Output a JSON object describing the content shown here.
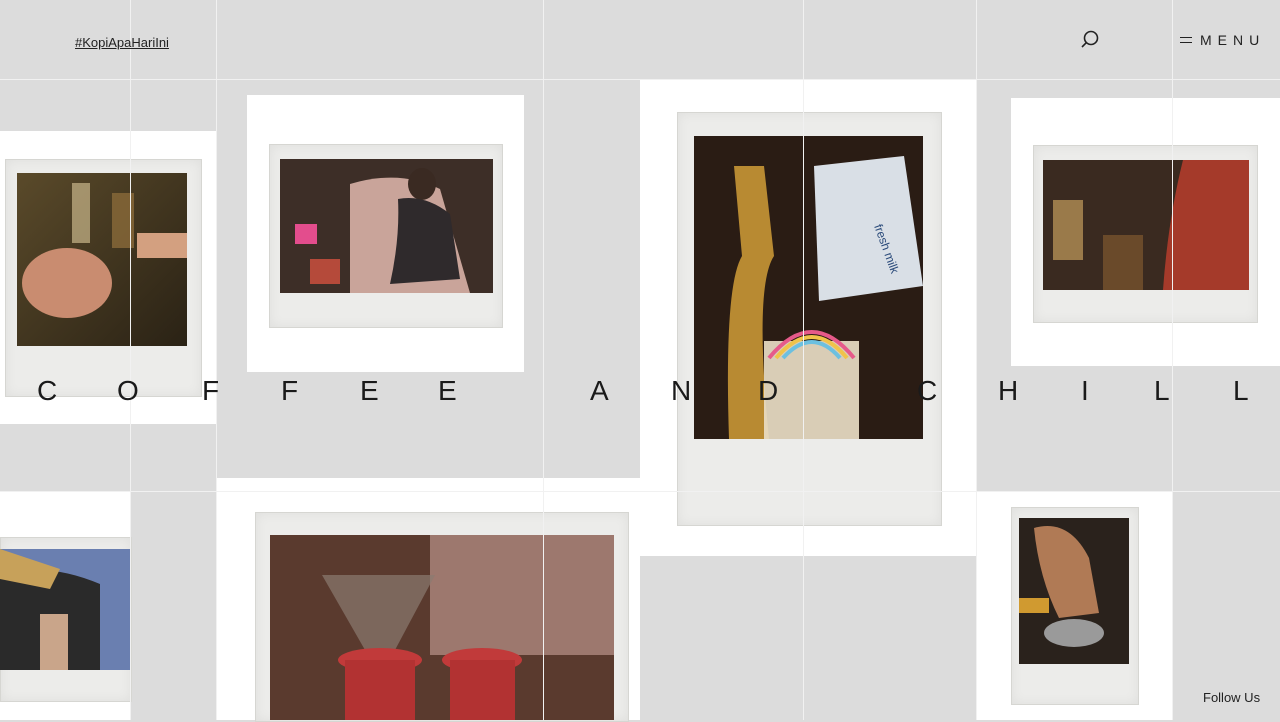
{
  "header": {
    "hashtag": "#KopiApaHariIni",
    "search_icon": "search-icon",
    "menu_icon": "hamburger-icon",
    "menu_label": "MENU"
  },
  "headline": {
    "letters": [
      "C",
      "O",
      "F",
      "F",
      "E",
      "E",
      "A",
      "N",
      "D",
      "C",
      "H",
      "I",
      "L",
      "L"
    ]
  },
  "footer": {
    "follow_label": "Follow Us"
  },
  "photos": [
    "barista-pouring-drink",
    "barista-brewing-pour-over",
    "milk-poured-into-glass-rainbow",
    "barista-pouring-kettle",
    "shaker-pouring-drink",
    "pour-over-drippers",
    "espresso-tamping"
  ],
  "colors": {
    "background": "#dcdcdc",
    "card": "#ffffff",
    "text": "#222222"
  }
}
